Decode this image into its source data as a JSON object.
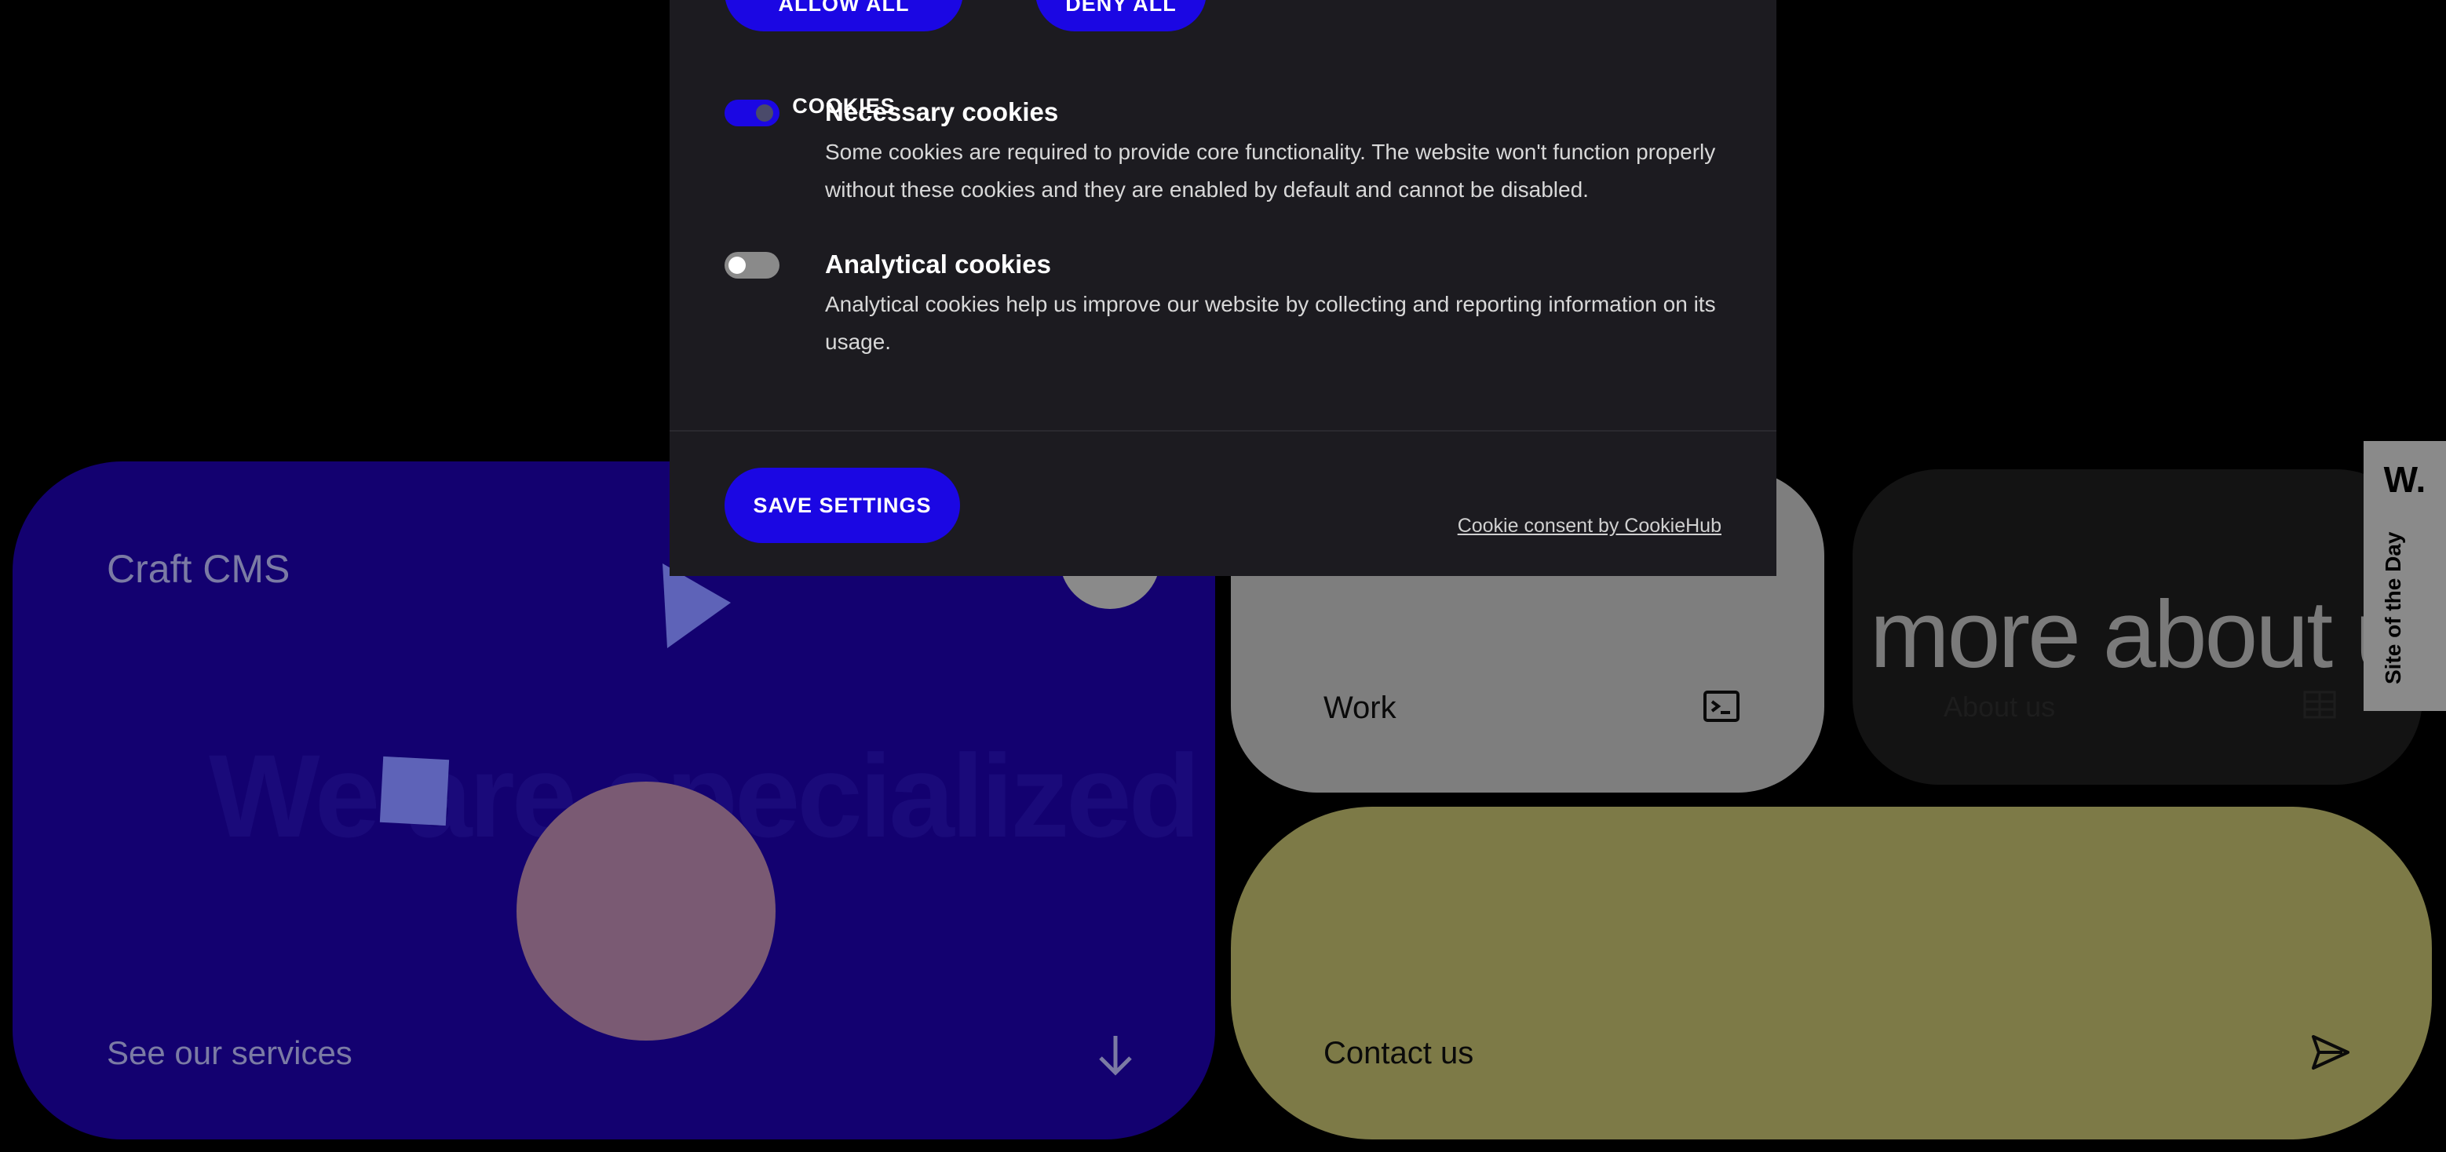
{
  "services_card": {
    "cms_label": "Craft CMS",
    "background_text": "We are specialized in",
    "link_label": "See our services",
    "color": "#130170"
  },
  "work_card": {
    "label": "Work",
    "icon": "terminal-icon",
    "color": "#7e7e7e"
  },
  "about_card": {
    "big_text": "more about us",
    "label": "About us",
    "icon": "building-icon",
    "color": "#131313"
  },
  "contact_card": {
    "label": "Contact us",
    "icon": "send-icon",
    "color": "#7d7a47"
  },
  "site_of_the_day": {
    "logo": "W.",
    "label": "Site of the Day"
  },
  "cookie_banner": {
    "allow_all_label": "ALLOW ALL COOKIES",
    "deny_all_label": "DENY ALL",
    "categories": [
      {
        "title": "Necessary cookies",
        "description": "Some cookies are required to provide core functionality. The website won't function properly without these cookies and they are enabled by default and cannot be disabled.",
        "enabled": true
      },
      {
        "title": "Analytical cookies",
        "description": "Analytical cookies help us improve our website by collecting and reporting information on its usage.",
        "enabled": false
      }
    ],
    "save_label": "SAVE SETTINGS",
    "credit_link": "Cookie consent by CookieHub",
    "accent_color": "#1b07e3"
  }
}
